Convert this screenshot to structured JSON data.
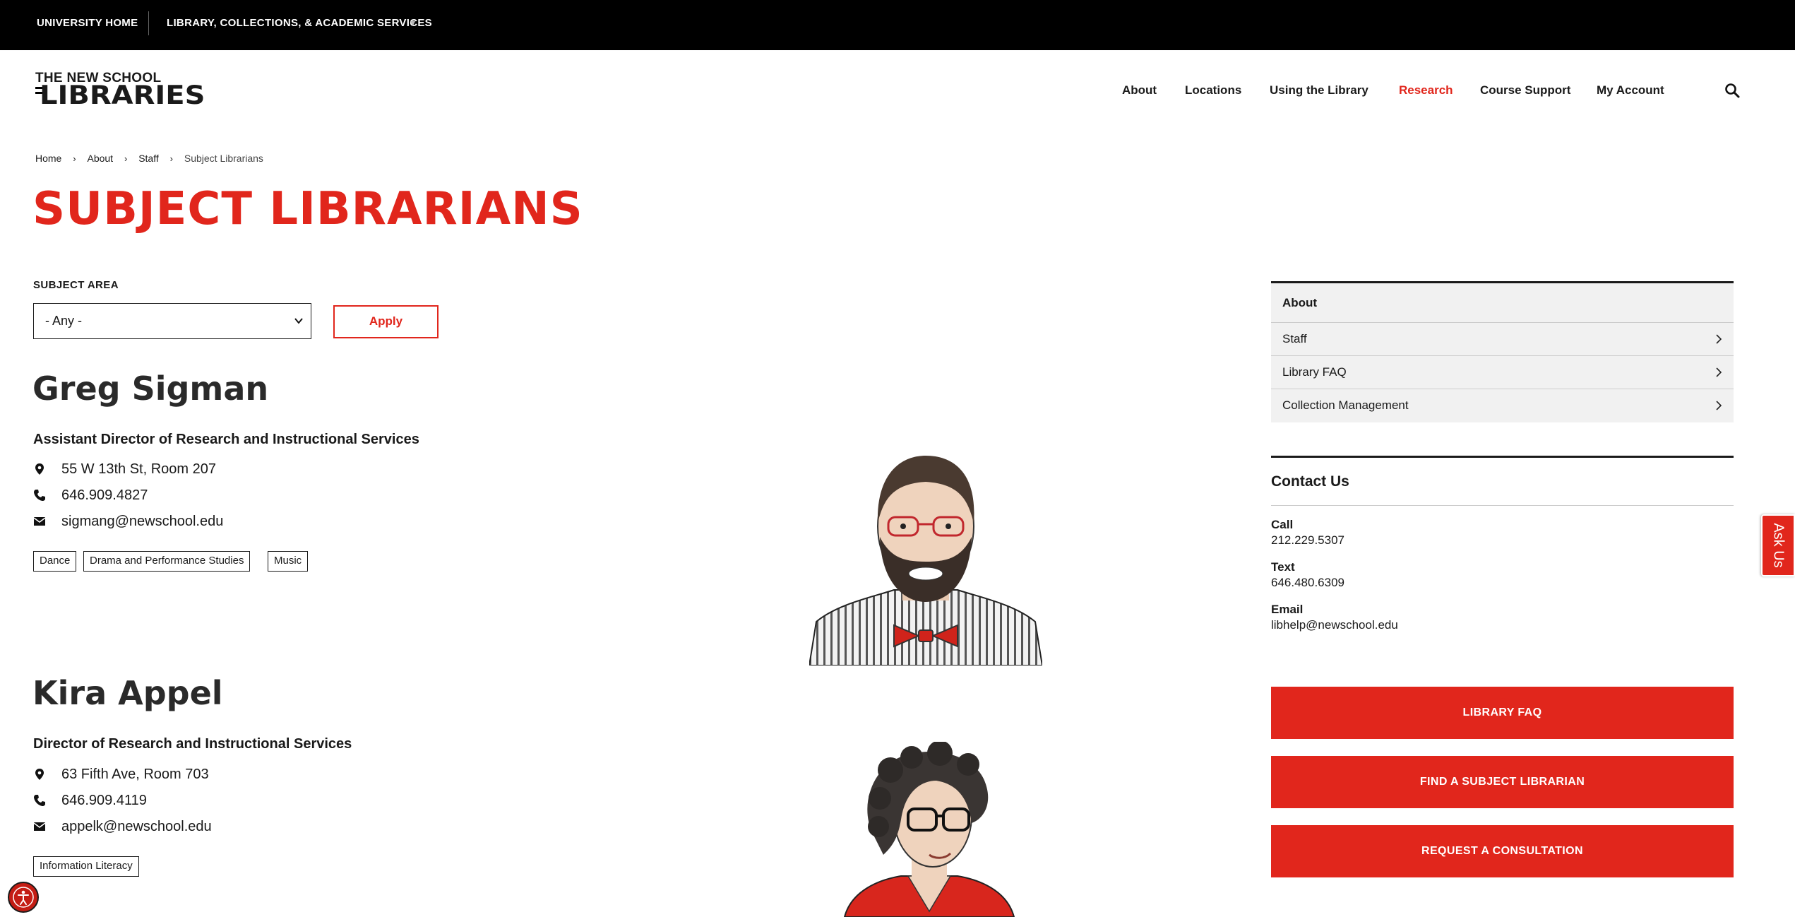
{
  "utility_bar": {
    "home_link": "UNIVERSITY HOME",
    "services_menu": "LIBRARY, COLLECTIONS, & ACADEMIC SERVICES",
    "caret": "▼"
  },
  "logo": {
    "line1": "THE NEW SCHOOL",
    "line2": "LIBRARIES"
  },
  "nav": {
    "items": [
      {
        "label": "About"
      },
      {
        "label": "Locations"
      },
      {
        "label": "Using the Library"
      },
      {
        "label": "Research",
        "active": true
      },
      {
        "label": "Course Support"
      },
      {
        "label": "My Account"
      }
    ],
    "search_icon": "search-icon"
  },
  "breadcrumb": {
    "items": [
      "Home",
      "About",
      "Staff"
    ],
    "separator": "›",
    "current": "Subject Librarians"
  },
  "page_title": "SUBJECT LIBRARIANS",
  "filter": {
    "label": "SUBJECT AREA",
    "selected": "- Any -",
    "apply_label": "Apply"
  },
  "staff": [
    {
      "name": "Greg Sigman",
      "title": "Assistant Director of Research and Instructional Services",
      "address": "55 W 13th St, Room 207",
      "phone": "646.909.4827",
      "email": "sigmang@newschool.edu",
      "tags": [
        "Dance",
        "Drama and Performance Studies",
        "Music"
      ]
    },
    {
      "name": "Kira Appel",
      "title": "Director of Research and Instructional Services",
      "address": " 63 Fifth Ave, Room 703",
      "phone": "646.909.4119",
      "email": "appelk@newschool.edu",
      "tags": [
        "Information Literacy"
      ]
    }
  ],
  "sidebar": {
    "heading": "About",
    "items": [
      {
        "label": "Staff"
      },
      {
        "label": "Library FAQ"
      },
      {
        "label": "Collection Management"
      }
    ]
  },
  "contact": {
    "heading": "Contact Us",
    "call_label": "Call",
    "call_value": "212.229.5307",
    "text_label": "Text",
    "text_value": "646.480.6309",
    "email_label": "Email",
    "email_value": "libhelp@newschool.edu"
  },
  "buttons": {
    "faq": "LIBRARY FAQ",
    "find_librarian": "FIND A SUBJECT LIBRARIAN",
    "consultation": "REQUEST A CONSULTATION"
  },
  "ask_us": "Ask Us",
  "colors": {
    "accent": "#e1261c",
    "bar": "#000000",
    "sidebar_bg": "#f1f1f1"
  }
}
